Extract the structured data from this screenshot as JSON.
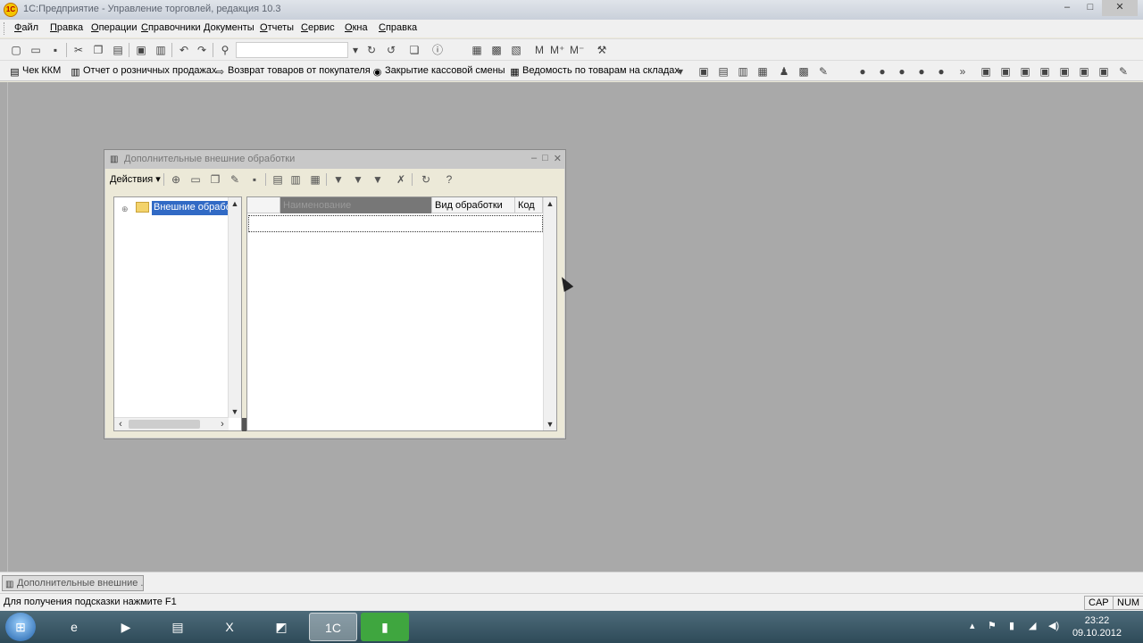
{
  "window": {
    "logo_text": "1C",
    "title": "1С:Предприятие - Управление торговлей, редакция 10.3",
    "min_label": "–",
    "max_label": "□",
    "close_label": "✕"
  },
  "menu": [
    "Файл",
    "Правка",
    "Операции",
    "Справочники",
    "Документы",
    "Отчеты",
    "Сервис",
    "Окна",
    "Справка"
  ],
  "toolbar2": [
    {
      "label": "Чек ККМ",
      "icon": "receipt-icon"
    },
    {
      "label": "Отчет о розничных продажах",
      "icon": "report-icon"
    },
    {
      "label": "Возврат товаров от покупателя",
      "icon": "return-arrow-icon"
    },
    {
      "label": "Закрытие кассовой смены",
      "icon": "cash-register-icon"
    },
    {
      "label": "Ведомость по товарам на складах",
      "icon": "warehouse-report-icon"
    }
  ],
  "child": {
    "title": "Дополнительные внешние обработки",
    "actions_label": "Действия",
    "tree_root": "Внешние обработки",
    "columns": [
      "Наименование",
      "Вид обработки",
      "Код"
    ]
  },
  "window_tab": "Дополнительные внешние ...",
  "status": {
    "hint": "Для получения подсказки нажмите F1",
    "cap": "CAP",
    "num": "NUM"
  },
  "clock": {
    "time": "23:22",
    "date": "09.10.2012"
  },
  "taskbar_apps": [
    {
      "name": "internet-explorer-icon",
      "glyph": "e"
    },
    {
      "name": "media-player-icon",
      "glyph": "▶"
    },
    {
      "name": "file-explorer-icon",
      "glyph": "▤"
    },
    {
      "name": "excel-icon",
      "glyph": "X"
    },
    {
      "name": "image-app-icon",
      "glyph": "◩"
    },
    {
      "name": "1c-enterprise-icon",
      "glyph": "1C"
    },
    {
      "name": "camera-app-icon",
      "glyph": "▮"
    }
  ]
}
